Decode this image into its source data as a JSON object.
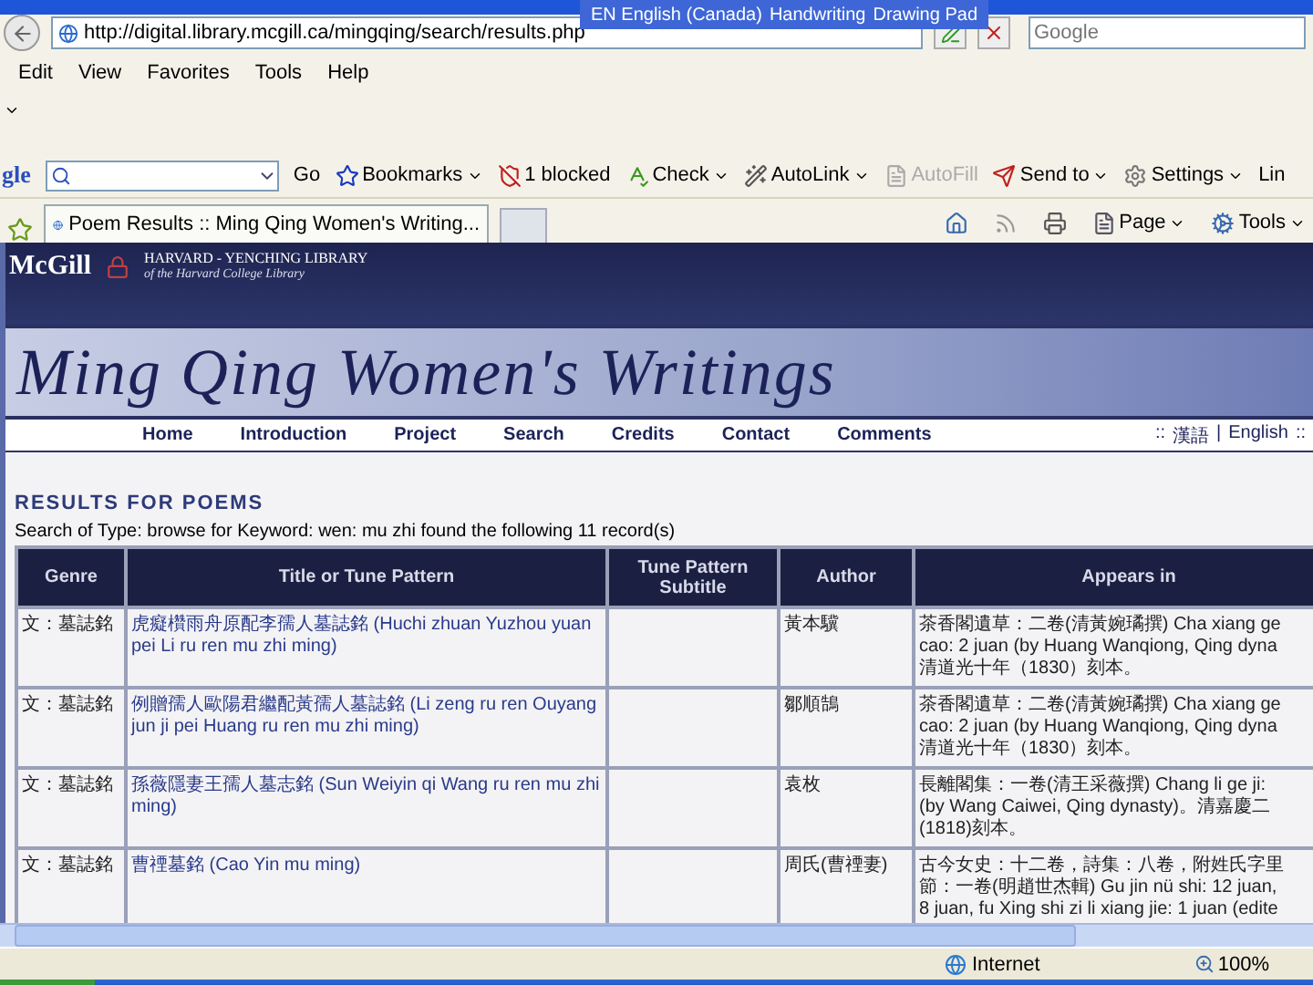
{
  "language_bar": {
    "items": [
      "EN English (Canada)",
      "Handwriting",
      "Drawing Pad"
    ]
  },
  "address_bar": {
    "url": "http://digital.library.mcgill.ca/mingqing/search/results.php",
    "search_placeholder": "Google"
  },
  "menu_bar": [
    "Edit",
    "View",
    "Favorites",
    "Tools",
    "Help"
  ],
  "google_toolbar": {
    "logo": "gle",
    "items": [
      {
        "kind": "go",
        "label": "Go",
        "dropdown": false,
        "disabled": false
      },
      {
        "kind": "bookmarks",
        "label": "Bookmarks",
        "dropdown": true,
        "disabled": false
      },
      {
        "kind": "blocked",
        "label": "1 blocked",
        "dropdown": false,
        "disabled": false
      },
      {
        "kind": "check",
        "label": "Check",
        "dropdown": true,
        "disabled": false
      },
      {
        "kind": "autolink",
        "label": "AutoLink",
        "dropdown": true,
        "disabled": false
      },
      {
        "kind": "autofill",
        "label": "AutoFill",
        "dropdown": false,
        "disabled": true
      },
      {
        "kind": "sendto",
        "label": "Send to",
        "dropdown": true,
        "disabled": false
      },
      {
        "kind": "settings",
        "label": "Settings",
        "dropdown": true,
        "disabled": false
      },
      {
        "kind": "links",
        "label": "Lin",
        "dropdown": false,
        "disabled": false
      }
    ]
  },
  "tab": {
    "title": "Poem Results :: Ming Qing Women's Writing..."
  },
  "command_bar": [
    {
      "kind": "page",
      "label": "Page"
    },
    {
      "kind": "tools",
      "label": "Tools"
    }
  ],
  "site": {
    "logo": "McGill",
    "library": "HARVARD - YENCHING LIBRARY",
    "library_sub": "of the Harvard College Library",
    "title": "Ming Qing Women's Writings",
    "nav": [
      "Home",
      "Introduction",
      "Project",
      "Search",
      "Credits",
      "Contact",
      "Comments"
    ],
    "languages": {
      "open": "::",
      "items": [
        "漢語",
        "English"
      ],
      "separator": "|",
      "close": "::"
    }
  },
  "results": {
    "heading": "RESULTS FOR POEMS",
    "summary": "Search of Type: browse for Keyword: wen: mu zhi found the following 11 record(s)",
    "columns": [
      "Genre",
      "Title or Tune Pattern",
      "Tune Pattern Subtitle",
      "Author",
      "Appears in"
    ],
    "rows": [
      {
        "genre": "文：墓誌銘",
        "title": "虎癡欑雨舟原配李孺人墓誌銘  (Huchi zhuan Yuzhou yuan pei Li ru ren mu zhi ming)",
        "author": "黃本驥",
        "appears_in": [
          "茶香閣遺草：二卷(清黃婉璚撰) Cha xiang ge",
          "cao: 2 juan (by Huang Wanqiong, Qing dyna",
          "清道光十年（1830）刻本。"
        ]
      },
      {
        "genre": "文：墓誌銘",
        "title": "例贈孺人歐陽君繼配黃孺人墓誌銘  (Li zeng ru ren Ouyang jun ji pei Huang ru ren mu zhi ming)",
        "author": "鄒順鵠",
        "appears_in": [
          "茶香閣遺草：二卷(清黃婉璚撰) Cha xiang ge",
          "cao: 2 juan (by Huang Wanqiong, Qing dyna",
          "清道光十年（1830）刻本。"
        ]
      },
      {
        "genre": "文：墓誌銘",
        "title": "孫薇隱妻王孺人墓志銘  (Sun Weiyin qi Wang ru ren mu zhi ming)",
        "author": "袁枚",
        "appears_in": [
          "長離閣集：一卷(清王采薇撰) Chang li ge ji:",
          "(by Wang Caiwei, Qing dynasty)。清嘉慶二",
          "(1818)刻本。"
        ]
      },
      {
        "genre": "文：墓誌銘",
        "title": "曹禋墓銘  (Cao Yin mu ming)",
        "author": "周氏(曹禋妻)",
        "appears_in": [
          "古今女史：十二卷，詩集：八卷，附姓氏字里",
          "節：一卷(明趙世杰輯) Gu jin nü shi: 12 juan,",
          "8 juan, fu Xing shi zi li xiang jie: 1 juan (edite"
        ]
      }
    ]
  },
  "status_bar": {
    "zone": "Internet",
    "zoom": "100%"
  }
}
